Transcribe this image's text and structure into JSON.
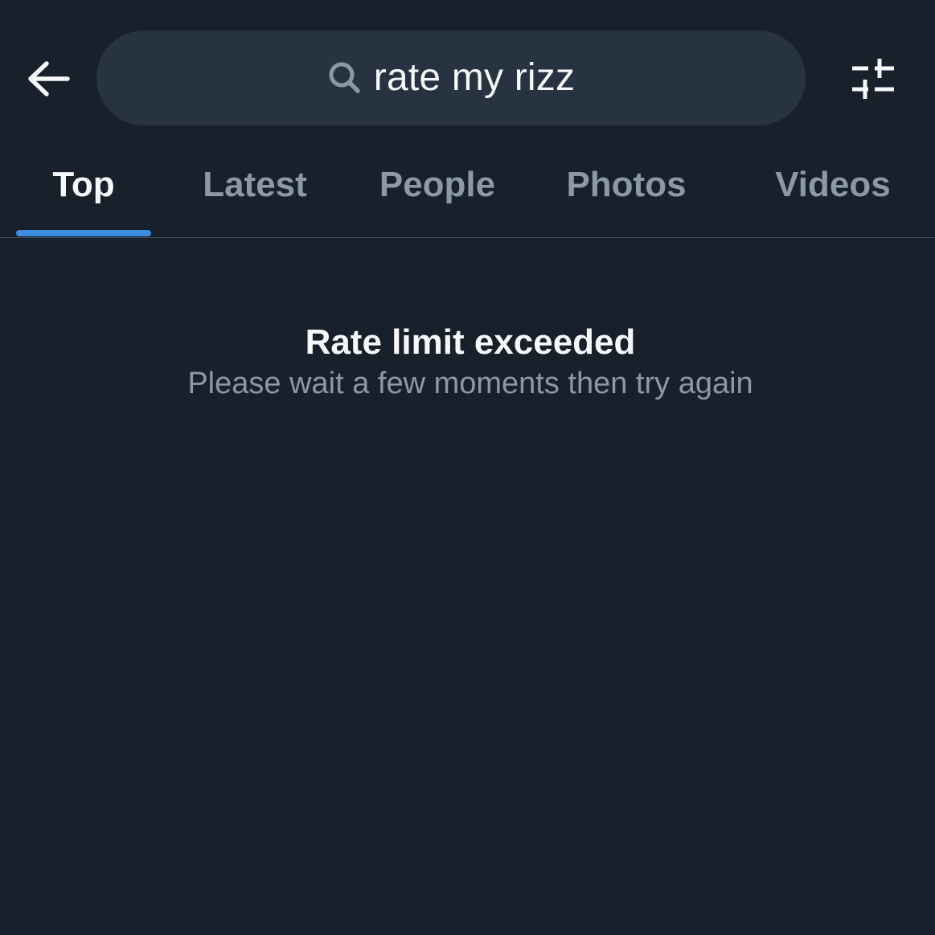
{
  "header": {
    "back_icon": "arrow-left-icon",
    "search": {
      "icon": "search-icon",
      "query": "rate my rizz"
    },
    "filter_icon": "sliders-icon"
  },
  "tabs": [
    {
      "label": "Top",
      "active": true
    },
    {
      "label": "Latest",
      "active": false
    },
    {
      "label": "People",
      "active": false
    },
    {
      "label": "Photos",
      "active": false
    },
    {
      "label": "Videos",
      "active": false
    }
  ],
  "message": {
    "title": "Rate limit exceeded",
    "subtitle": "Please wait a few moments then try again"
  },
  "colors": {
    "background": "#18202b",
    "search_background": "#273340",
    "primary_text": "#f5f7f9",
    "secondary_text": "#8b98a5",
    "accent": "#3c8de0",
    "divider": "#404c57"
  }
}
